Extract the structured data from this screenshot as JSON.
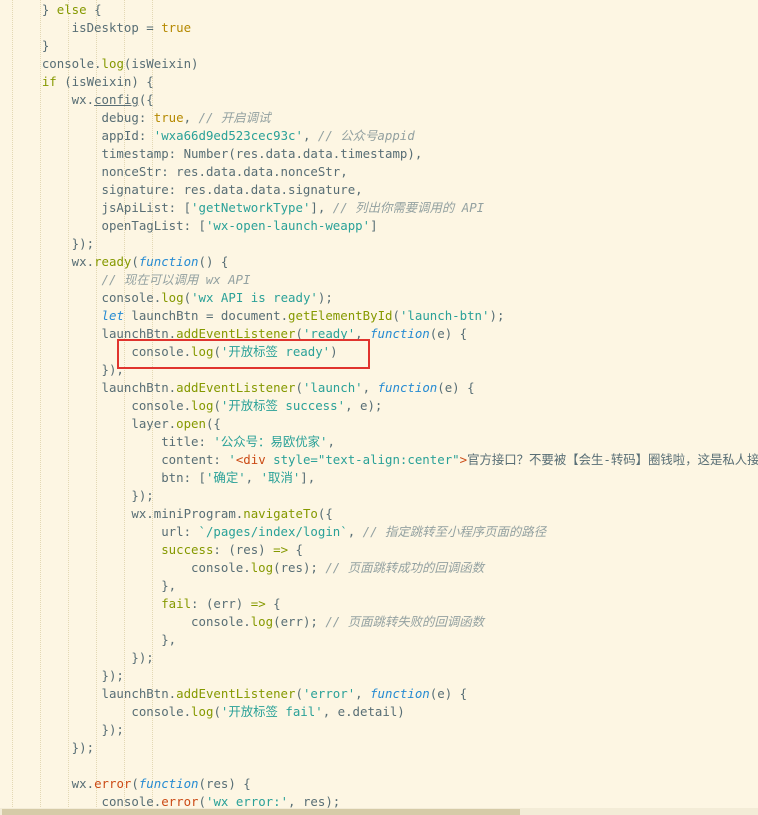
{
  "editor": {
    "lines": [
      [
        [
          "id",
          "    } "
        ],
        [
          "kw",
          "else"
        ],
        [
          "id",
          " {"
        ]
      ],
      [
        [
          "id",
          "        isDesktop = "
        ],
        [
          "bool",
          "true"
        ]
      ],
      [
        [
          "id",
          "    }"
        ]
      ],
      [
        [
          "id",
          "    console."
        ],
        [
          "fn",
          "log"
        ],
        [
          "id",
          "(isWeixin)"
        ]
      ],
      [
        [
          "id",
          "    "
        ],
        [
          "kw",
          "if"
        ],
        [
          "id",
          " (isWeixin) {"
        ]
      ],
      [
        [
          "id",
          "        wx."
        ],
        [
          "und",
          "config"
        ],
        [
          "id",
          "({"
        ]
      ],
      [
        [
          "id",
          "            debug: "
        ],
        [
          "bool",
          "true"
        ],
        [
          "id",
          ", "
        ],
        [
          "cmt",
          "// 开启调试"
        ]
      ],
      [
        [
          "id",
          "            appId: "
        ],
        [
          "str",
          "'wxa66d9ed523cec93c'"
        ],
        [
          "id",
          ", "
        ],
        [
          "cmt",
          "// 公众号appid"
        ]
      ],
      [
        [
          "id",
          "            timestamp: Number(res.data.data.timestamp),"
        ]
      ],
      [
        [
          "id",
          "            nonceStr: res.data.data.nonceStr,"
        ]
      ],
      [
        [
          "id",
          "            signature: res.data.data.signature,"
        ]
      ],
      [
        [
          "id",
          "            jsApiList: ["
        ],
        [
          "str",
          "'getNetworkType'"
        ],
        [
          "id",
          "], "
        ],
        [
          "cmt",
          "// 列出你需要调用的 API"
        ]
      ],
      [
        [
          "id",
          "            openTagList: ["
        ],
        [
          "str",
          "'wx-open-launch-weapp'"
        ],
        [
          "id",
          "]"
        ]
      ],
      [
        [
          "id",
          "        });"
        ]
      ],
      [
        [
          "id",
          "        wx."
        ],
        [
          "fn",
          "ready"
        ],
        [
          "id",
          "("
        ],
        [
          "fnkw",
          "function"
        ],
        [
          "id",
          "() {"
        ]
      ],
      [
        [
          "id",
          "            "
        ],
        [
          "cmt",
          "// 现在可以调用 wx API"
        ]
      ],
      [
        [
          "id",
          "            console."
        ],
        [
          "fn",
          "log"
        ],
        [
          "id",
          "("
        ],
        [
          "str",
          "'wx API is ready'"
        ],
        [
          "id",
          ");"
        ]
      ],
      [
        [
          "id",
          "            "
        ],
        [
          "fnkw",
          "let"
        ],
        [
          "id",
          " launchBtn = document."
        ],
        [
          "fn",
          "getElementById"
        ],
        [
          "id",
          "("
        ],
        [
          "str",
          "'launch-btn'"
        ],
        [
          "id",
          ");"
        ]
      ],
      [
        [
          "id",
          "            launchBtn."
        ],
        [
          "fn",
          "addEventListener"
        ],
        [
          "id",
          "("
        ],
        [
          "str",
          "'ready'"
        ],
        [
          "id",
          ", "
        ],
        [
          "fnkw",
          "function"
        ],
        [
          "id",
          "(e) {"
        ]
      ],
      [
        [
          "id",
          "                console."
        ],
        [
          "fn",
          "log"
        ],
        [
          "id",
          "("
        ],
        [
          "str",
          "'开放标签 ready'"
        ],
        [
          "id",
          ")"
        ]
      ],
      [
        [
          "id",
          "            });"
        ]
      ],
      [
        [
          "id",
          "            launchBtn."
        ],
        [
          "fn",
          "addEventListener"
        ],
        [
          "id",
          "("
        ],
        [
          "str",
          "'launch'"
        ],
        [
          "id",
          ", "
        ],
        [
          "fnkw",
          "function"
        ],
        [
          "id",
          "(e) {"
        ]
      ],
      [
        [
          "id",
          "                console."
        ],
        [
          "fn",
          "log"
        ],
        [
          "id",
          "("
        ],
        [
          "str",
          "'开放标签 success'"
        ],
        [
          "id",
          ", e);"
        ]
      ],
      [
        [
          "id",
          "                layer."
        ],
        [
          "fn",
          "open"
        ],
        [
          "id",
          "({"
        ]
      ],
      [
        [
          "id",
          "                    title: "
        ],
        [
          "str",
          "'公众号：易欧优家'"
        ],
        [
          "id",
          ","
        ]
      ],
      [
        [
          "id",
          "                    content: "
        ],
        [
          "str",
          "'"
        ],
        [
          "tag",
          "<div"
        ],
        [
          "str",
          " style=\"text-align:center\""
        ],
        [
          "tag",
          ">"
        ],
        [
          "id",
          "官方接口？不要被【会生-转码】圈钱啦，这是私人接口"
        ]
      ],
      [
        [
          "id",
          "                    btn: ["
        ],
        [
          "str",
          "'确定'"
        ],
        [
          "id",
          ", "
        ],
        [
          "str",
          "'取消'"
        ],
        [
          "id",
          "],"
        ]
      ],
      [
        [
          "id",
          "                });"
        ]
      ],
      [
        [
          "id",
          "                wx.miniProgram."
        ],
        [
          "fn",
          "navigateTo"
        ],
        [
          "id",
          "({"
        ]
      ],
      [
        [
          "id",
          "                    url: "
        ],
        [
          "str",
          "`/pages/index/login`"
        ],
        [
          "id",
          ", "
        ],
        [
          "cmt",
          "// 指定跳转至小程序页面的路径"
        ]
      ],
      [
        [
          "kw",
          "                    success"
        ],
        [
          "id",
          ": (res) "
        ],
        [
          "kw",
          "=>"
        ],
        [
          "id",
          " {"
        ]
      ],
      [
        [
          "id",
          "                        console."
        ],
        [
          "fn",
          "log"
        ],
        [
          "id",
          "(res); "
        ],
        [
          "cmt",
          "// 页面跳转成功的回调函数"
        ]
      ],
      [
        [
          "id",
          "                    },"
        ]
      ],
      [
        [
          "kw",
          "                    fail"
        ],
        [
          "id",
          ": (err) "
        ],
        [
          "kw",
          "=>"
        ],
        [
          "id",
          " {"
        ]
      ],
      [
        [
          "id",
          "                        console."
        ],
        [
          "fn",
          "log"
        ],
        [
          "id",
          "(err); "
        ],
        [
          "cmt",
          "// 页面跳转失败的回调函数"
        ]
      ],
      [
        [
          "id",
          "                    },"
        ]
      ],
      [
        [
          "id",
          "                });"
        ]
      ],
      [
        [
          "id",
          "            });"
        ]
      ],
      [
        [
          "id",
          "            launchBtn."
        ],
        [
          "fn",
          "addEventListener"
        ],
        [
          "id",
          "("
        ],
        [
          "str",
          "'error'"
        ],
        [
          "id",
          ", "
        ],
        [
          "fnkw",
          "function"
        ],
        [
          "id",
          "(e) {"
        ]
      ],
      [
        [
          "id",
          "                console."
        ],
        [
          "fn",
          "log"
        ],
        [
          "id",
          "("
        ],
        [
          "str",
          "'开放标签 fail'"
        ],
        [
          "id",
          ", e.detail)"
        ]
      ],
      [
        [
          "id",
          "            });"
        ]
      ],
      [
        [
          "id",
          "        });"
        ]
      ],
      [
        [
          "id",
          ""
        ]
      ],
      [
        [
          "id",
          "        wx."
        ],
        [
          "err",
          "error"
        ],
        [
          "id",
          "("
        ],
        [
          "fnkw",
          "function"
        ],
        [
          "id",
          "(res) {"
        ]
      ],
      [
        [
          "id",
          "            console."
        ],
        [
          "err",
          "error"
        ],
        [
          "id",
          "("
        ],
        [
          "str",
          "'wx error:'"
        ],
        [
          "id",
          ", res);"
        ]
      ]
    ]
  },
  "colors": {
    "background": "#fdf6e3",
    "keyword": "#859900",
    "string": "#2aa198",
    "comment": "#93a1a1",
    "highlight_border": "#e0342e"
  }
}
